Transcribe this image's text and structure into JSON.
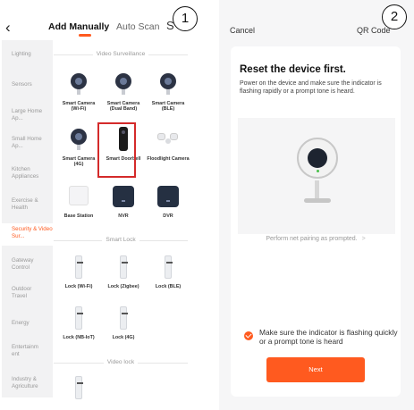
{
  "step_badges": [
    "1",
    "2"
  ],
  "left": {
    "back_icon": "back-arrow-icon",
    "tabs": [
      {
        "label": "Add Manually",
        "active": true
      },
      {
        "label": "Auto Scan",
        "active": false
      }
    ],
    "tab_extra": "S",
    "accent_color": "#ff5a1f",
    "sidebar": [
      {
        "label": "Lighting"
      },
      {
        "label": "Sensors"
      },
      {
        "label": "Large Home Ap..."
      },
      {
        "label": "Small Home Ap..."
      },
      {
        "label": "Kitchen Appliances"
      },
      {
        "label": "Exercise & Health"
      },
      {
        "label": "Security & Video Sur...",
        "active": true
      },
      {
        "label": "Gateway Control"
      },
      {
        "label": "Outdoor Travel"
      },
      {
        "label": "Energy"
      },
      {
        "label": "Entertainm ent"
      },
      {
        "label": "Industry & Agriculture"
      }
    ],
    "sections": [
      {
        "title": "Video Surveillance",
        "devices": [
          {
            "label": "Smart Camera (Wi-Fi)",
            "icon": "camera-icon"
          },
          {
            "label": "Smart Camera (Dual Band)",
            "icon": "camera-icon"
          },
          {
            "label": "Smart Camera (BLE)",
            "icon": "camera-icon"
          },
          {
            "label": "Smart Camera (4G)",
            "icon": "camera-icon"
          },
          {
            "label": "Smart Doorbell",
            "icon": "doorbell-icon",
            "highlighted": true
          },
          {
            "label": "Floodlight Camera",
            "icon": "floodlight-icon"
          },
          {
            "label": "Base Station",
            "icon": "base-station-icon"
          },
          {
            "label": "NVR",
            "icon": "nvr-icon"
          },
          {
            "label": "DVR",
            "icon": "dvr-icon"
          }
        ]
      },
      {
        "title": "Smart Lock",
        "devices": [
          {
            "label": "Lock (Wi-Fi)",
            "icon": "lock-icon"
          },
          {
            "label": "Lock (Zigbee)",
            "icon": "lock-icon"
          },
          {
            "label": "Lock (BLE)",
            "icon": "lock-icon"
          },
          {
            "label": "Lock (NB-IoT)",
            "icon": "lock-icon"
          },
          {
            "label": "Lock (4G)",
            "icon": "lock-icon"
          }
        ]
      },
      {
        "title": "Video lock",
        "devices": [
          {
            "label": "",
            "icon": "lock-icon"
          }
        ]
      }
    ]
  },
  "right": {
    "cancel_label": "Cancel",
    "qr_label": "QR Code",
    "title": "Reset the device first.",
    "description": "Power on the device and make sure the indicator is flashing rapidly or a prompt tone is heard.",
    "illustration_icon": "camera-illustration-icon",
    "pairing_text": "Perform net pairing as prompted.",
    "pairing_chevron": ">",
    "confirm_checked": true,
    "confirm_text": "Make sure the indicator is flashing quickly or a prompt tone is heard",
    "next_label": "Next"
  }
}
